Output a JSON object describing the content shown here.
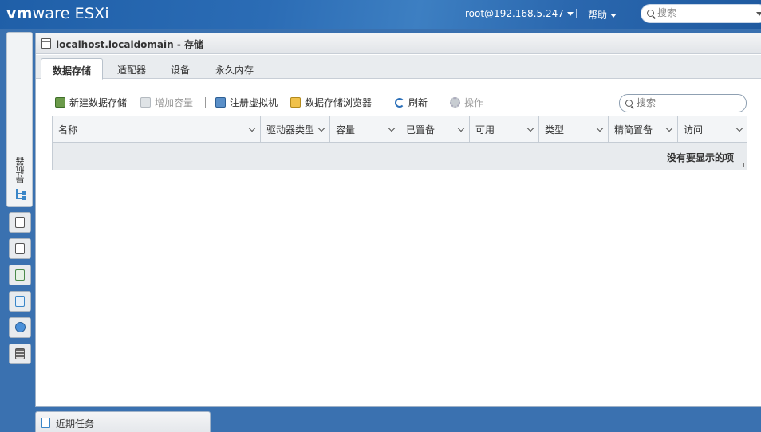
{
  "header": {
    "brand_vm": "vm",
    "brand_ware": "ware",
    "brand_product": "ESXi",
    "user": "root@192.168.5.247",
    "help": "帮助",
    "search_placeholder": "搜索"
  },
  "navigator": {
    "label": "导航器"
  },
  "window": {
    "title": "localhost.localdomain - 存储",
    "tabs": [
      "数据存储",
      "适配器",
      "设备",
      "永久内存"
    ],
    "active_tab": "数据存储"
  },
  "toolbar": {
    "new_datastore": "新建数据存储",
    "increase_capacity": "增加容量",
    "register_vm": "注册虚拟机",
    "datastore_browser": "数据存储浏览器",
    "refresh": "刷新",
    "actions": "操作",
    "search_placeholder": "搜索"
  },
  "table": {
    "columns": [
      "名称",
      "驱动器类型",
      "容量",
      "已置备",
      "可用",
      "类型",
      "精简置备",
      "访问"
    ],
    "empty_message": "没有要显示的项"
  },
  "recent_tasks": {
    "label": "近期任务"
  },
  "colors": {
    "header_blue": "#2b6cb5",
    "panel_bg": "#e9ecef"
  }
}
